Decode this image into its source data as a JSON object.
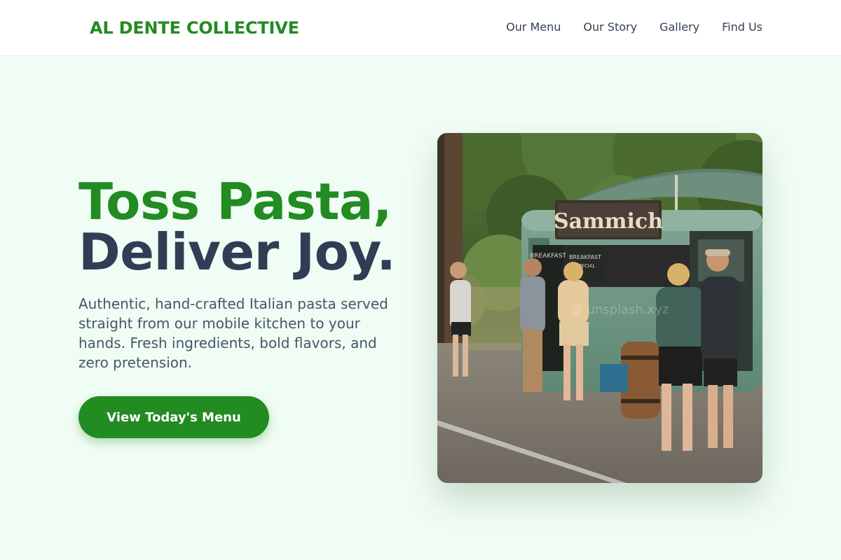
{
  "brand": {
    "name": "AL DENTE COLLECTIVE",
    "color": "#228b22"
  },
  "nav": {
    "items": [
      {
        "label": "Our Menu"
      },
      {
        "label": "Our Story"
      },
      {
        "label": "Gallery"
      },
      {
        "label": "Find Us"
      }
    ]
  },
  "hero": {
    "title_line1": "Toss Pasta,",
    "title_line2": "Deliver Joy.",
    "subtitle": "Authentic, hand-crafted Italian pasta served straight from our mobile kitchen to your hands. Fresh ingredients, bold flavors, and zero pretension.",
    "cta_label": "View Today's Menu"
  },
  "photo": {
    "alt": "Food truck with customers in a park",
    "sign_text": "Sammich",
    "board_left_text": "BREAKFAST",
    "board_right_text": "BREAKFAST",
    "board_right_sub": "SPECIAL",
    "watermark_text": "@ unsplash.xyz"
  },
  "colors": {
    "accent": "#228b22",
    "heading_dark": "#2f3e55",
    "background": "#f0fdf4"
  }
}
